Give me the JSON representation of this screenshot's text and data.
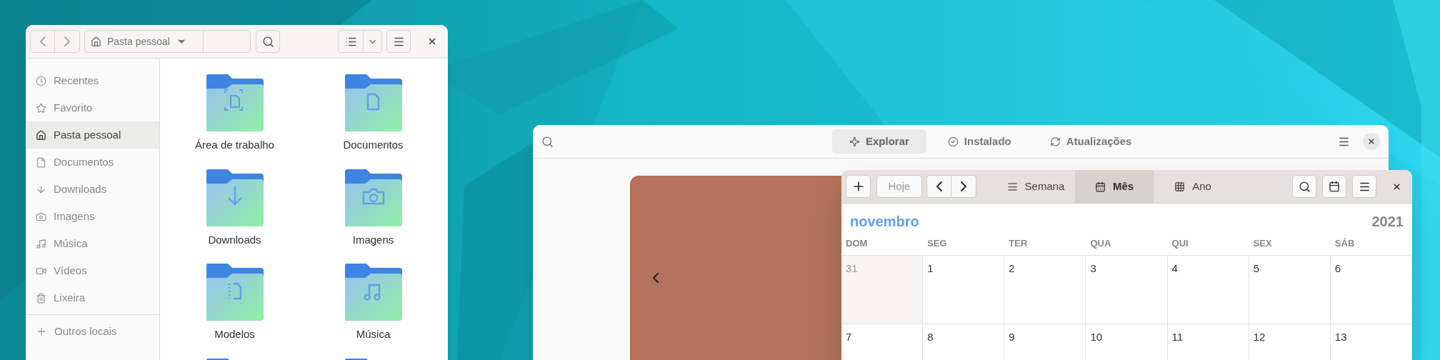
{
  "file_manager": {
    "path": "Pasta pessoal",
    "sidebar": [
      {
        "label": "Recentes",
        "selected": false
      },
      {
        "label": "Favorito",
        "selected": false
      },
      {
        "label": "Pasta pessoal",
        "selected": true
      },
      {
        "label": "Documentos",
        "selected": false
      },
      {
        "label": "Downloads",
        "selected": false
      },
      {
        "label": "Imagens",
        "selected": false
      },
      {
        "label": "Música",
        "selected": false
      },
      {
        "label": "Vídeos",
        "selected": false
      },
      {
        "label": "Lixeira",
        "selected": false
      }
    ],
    "other_locations": "Outros locais",
    "folders": [
      "Área de trabalho",
      "Documentos",
      "Downloads",
      "Imagens",
      "Modelos",
      "Música"
    ]
  },
  "software": {
    "tabs": [
      {
        "label": "Explorar",
        "selected": true
      },
      {
        "label": "Instalado",
        "selected": false
      },
      {
        "label": "Atualizações",
        "selected": false
      }
    ]
  },
  "calendar": {
    "today_button": "Hoje",
    "views": [
      {
        "label": "Semana",
        "selected": false
      },
      {
        "label": "Mês",
        "selected": true
      },
      {
        "label": "Ano",
        "selected": false
      }
    ],
    "month": "novembro",
    "year": "2021",
    "weekdays": [
      "DOM",
      "SEG",
      "TER",
      "QUA",
      "QUI",
      "SEX",
      "SÁB"
    ],
    "weeks": [
      [
        {
          "day": "31",
          "other_month": true
        },
        {
          "day": "1",
          "other_month": false
        },
        {
          "day": "2",
          "other_month": false
        },
        {
          "day": "3",
          "other_month": false
        },
        {
          "day": "4",
          "other_month": false
        },
        {
          "day": "5",
          "other_month": false
        },
        {
          "day": "6",
          "other_month": false
        }
      ],
      [
        {
          "day": "7",
          "other_month": false
        },
        {
          "day": "8",
          "other_month": false
        },
        {
          "day": "9",
          "other_month": false
        },
        {
          "day": "10",
          "other_month": false
        },
        {
          "day": "11",
          "other_month": false
        },
        {
          "day": "12",
          "other_month": false
        },
        {
          "day": "13",
          "other_month": false
        }
      ]
    ]
  }
}
